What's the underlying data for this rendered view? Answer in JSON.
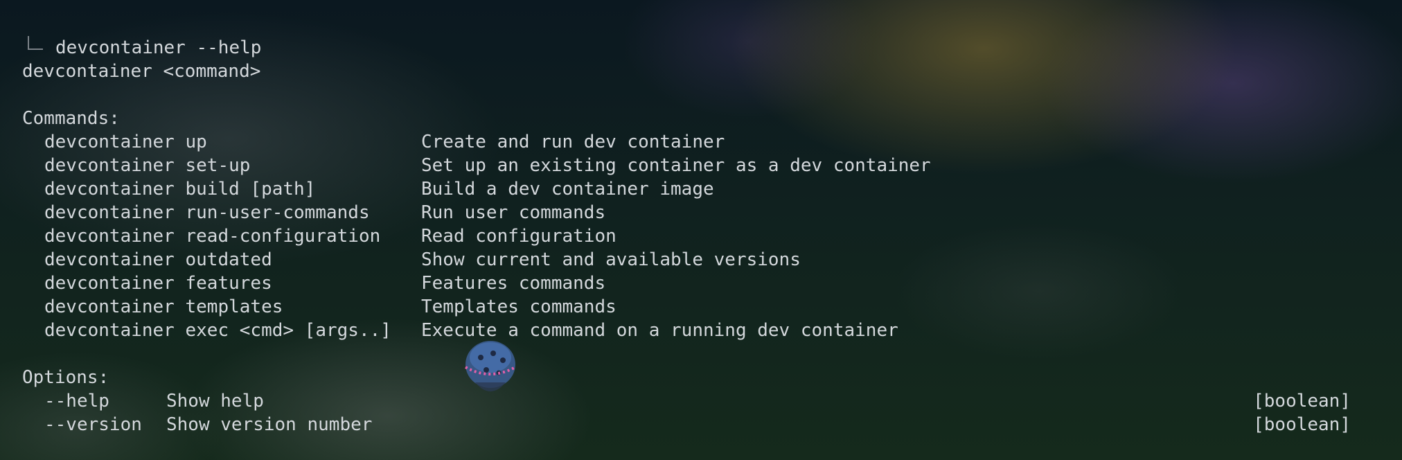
{
  "prompt": {
    "command": "devcontainer --help"
  },
  "usage": "devcontainer <command>",
  "commands_heading": "Commands:",
  "commands": [
    {
      "name": "devcontainer up",
      "description": "Create and run dev container"
    },
    {
      "name": "devcontainer set-up",
      "description": "Set up an existing container as a dev container"
    },
    {
      "name": "devcontainer build [path]",
      "description": "Build a dev container image"
    },
    {
      "name": "devcontainer run-user-commands",
      "description": "Run user commands"
    },
    {
      "name": "devcontainer read-configuration",
      "description": "Read configuration"
    },
    {
      "name": "devcontainer outdated",
      "description": "Show current and available versions"
    },
    {
      "name": "devcontainer features",
      "description": "Features commands"
    },
    {
      "name": "devcontainer templates",
      "description": "Templates commands"
    },
    {
      "name": "devcontainer exec <cmd> [args..]",
      "description": "Execute a command on a running dev container"
    }
  ],
  "options_heading": "Options:",
  "options": [
    {
      "flag": "--help",
      "description": "Show help",
      "type": "[boolean]"
    },
    {
      "flag": "--version",
      "description": "Show version number",
      "type": "[boolean]"
    }
  ],
  "colors": {
    "text": "#d4d8dc",
    "prompt_glyph": "#7b8288"
  }
}
